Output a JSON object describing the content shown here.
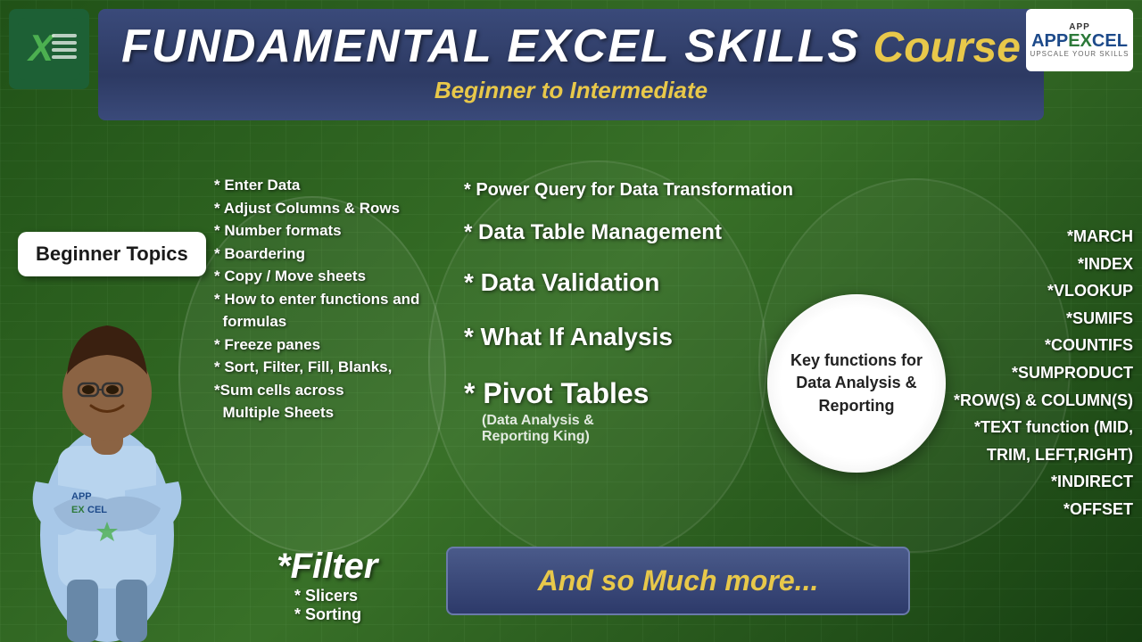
{
  "header": {
    "title_main": "FUNDAMENTAL EXCEL SKILLS",
    "title_course": "Course",
    "subtitle": "Beginner to Intermediate"
  },
  "excel_logo": {
    "text": "X"
  },
  "appexcel_logo": {
    "top": "APP",
    "main_prefix": "APP",
    "main_excel": "EXCEL",
    "sub": "UPSCALE YOUR SKILLS"
  },
  "beginner_bubble": {
    "label": "Beginner Topics"
  },
  "beginner_list": {
    "items": [
      "* Enter Data",
      "* Adjust Columns & Rows",
      "* Number formats",
      "* Boardering",
      "* Copy / Move sheets",
      "* How to enter functions and",
      "   formulas",
      "* Freeze panes",
      "* Sort, Filter, Fill, Blanks,",
      "*Sum cells across",
      "   Multiple Sheets"
    ]
  },
  "middle_topics": {
    "items": [
      "* Power Query for Data Transformation",
      "* Data Table Management",
      "* Data Validation",
      "* What If Analysis",
      "* Pivot Tables"
    ],
    "pivot_subtitle": "(Data Analysis &\nReporting King)"
  },
  "key_functions_circle": {
    "line1": "Key functions for",
    "line2": "Data Analysis &",
    "line3": "Reporting"
  },
  "right_functions": {
    "items": [
      "*MARCH",
      "*INDEX",
      "*VLOOKUP",
      "*SUMIFS",
      "*COUNTIFS",
      "*SUMPRODUCT",
      "*ROW(S) & COLUMN(S)",
      "*TEXT function (MID,",
      "TRIM, LEFT,RIGHT)",
      "*INDIRECT",
      "*OFFSET"
    ]
  },
  "bottom_filter": {
    "main": "*Filter",
    "sub1": "* Slicers",
    "sub2": "* Sorting"
  },
  "more_button": {
    "label": "And so Much more..."
  }
}
